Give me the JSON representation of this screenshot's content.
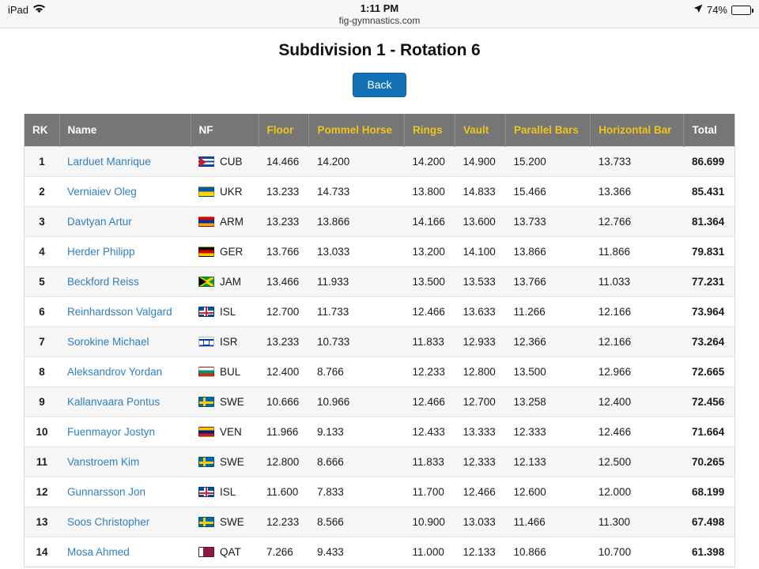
{
  "statusbar": {
    "device": "iPad",
    "wifi_icon": "wifi-icon",
    "time": "1:11 PM",
    "url": "fig-gymnastics.com",
    "location_icon": "location-arrow-icon",
    "battery_percent": "74%",
    "battery_level": 74
  },
  "header": {
    "title": "Subdivision 1 - Rotation 6",
    "back_label": "Back"
  },
  "colors": {
    "header_bg": "#767676",
    "header_apparatus_text": "#f0c419",
    "link": "#2f7fc1",
    "button_bg": "#1272b5"
  },
  "table": {
    "columns": [
      {
        "key": "rk",
        "label": "RK",
        "apparatus": false
      },
      {
        "key": "name",
        "label": "Name",
        "apparatus": false
      },
      {
        "key": "nf",
        "label": "NF",
        "apparatus": false
      },
      {
        "key": "floor",
        "label": "Floor",
        "apparatus": true
      },
      {
        "key": "pommel",
        "label": "Pommel Horse",
        "apparatus": true
      },
      {
        "key": "rings",
        "label": "Rings",
        "apparatus": true
      },
      {
        "key": "vault",
        "label": "Vault",
        "apparatus": true
      },
      {
        "key": "pbars",
        "label": "Parallel Bars",
        "apparatus": true
      },
      {
        "key": "hbar",
        "label": "Horizontal Bar",
        "apparatus": true
      },
      {
        "key": "total",
        "label": "Total",
        "apparatus": false
      }
    ],
    "rows": [
      {
        "rk": "1",
        "name": "Larduet Manrique",
        "nf": "CUB",
        "floor": "14.466",
        "pommel": "14.200",
        "rings": "14.200",
        "vault": "14.900",
        "pbars": "15.200",
        "hbar": "13.733",
        "total": "86.699"
      },
      {
        "rk": "2",
        "name": "Verniaiev Oleg",
        "nf": "UKR",
        "floor": "13.233",
        "pommel": "14.733",
        "rings": "13.800",
        "vault": "14.833",
        "pbars": "15.466",
        "hbar": "13.366",
        "total": "85.431"
      },
      {
        "rk": "3",
        "name": "Davtyan Artur",
        "nf": "ARM",
        "floor": "13.233",
        "pommel": "13.866",
        "rings": "14.166",
        "vault": "13.600",
        "pbars": "13.733",
        "hbar": "12.766",
        "total": "81.364"
      },
      {
        "rk": "4",
        "name": "Herder Philipp",
        "nf": "GER",
        "floor": "13.766",
        "pommel": "13.033",
        "rings": "13.200",
        "vault": "14.100",
        "pbars": "13.866",
        "hbar": "11.866",
        "total": "79.831"
      },
      {
        "rk": "5",
        "name": "Beckford Reiss",
        "nf": "JAM",
        "floor": "13.466",
        "pommel": "11.933",
        "rings": "13.500",
        "vault": "13.533",
        "pbars": "13.766",
        "hbar": "11.033",
        "total": "77.231"
      },
      {
        "rk": "6",
        "name": "Reinhardsson Valgard",
        "nf": "ISL",
        "floor": "12.700",
        "pommel": "11.733",
        "rings": "12.466",
        "vault": "13.633",
        "pbars": "11.266",
        "hbar": "12.166",
        "total": "73.964"
      },
      {
        "rk": "7",
        "name": "Sorokine Michael",
        "nf": "ISR",
        "floor": "13.233",
        "pommel": "10.733",
        "rings": "11.833",
        "vault": "12.933",
        "pbars": "12.366",
        "hbar": "12.166",
        "total": "73.264"
      },
      {
        "rk": "8",
        "name": "Aleksandrov Yordan",
        "nf": "BUL",
        "floor": "12.400",
        "pommel": "8.766",
        "rings": "12.233",
        "vault": "12.800",
        "pbars": "13.500",
        "hbar": "12.966",
        "total": "72.665"
      },
      {
        "rk": "9",
        "name": "Kallanvaara Pontus",
        "nf": "SWE",
        "floor": "10.666",
        "pommel": "10.966",
        "rings": "12.466",
        "vault": "12.700",
        "pbars": "13.258",
        "hbar": "12.400",
        "total": "72.456"
      },
      {
        "rk": "10",
        "name": "Fuenmayor Jostyn",
        "nf": "VEN",
        "floor": "11.966",
        "pommel": "9.133",
        "rings": "12.433",
        "vault": "13.333",
        "pbars": "12.333",
        "hbar": "12.466",
        "total": "71.664"
      },
      {
        "rk": "11",
        "name": "Vanstroem Kim",
        "nf": "SWE",
        "floor": "12.800",
        "pommel": "8.666",
        "rings": "11.833",
        "vault": "12.333",
        "pbars": "12.133",
        "hbar": "12.500",
        "total": "70.265"
      },
      {
        "rk": "12",
        "name": "Gunnarsson Jon",
        "nf": "ISL",
        "floor": "11.600",
        "pommel": "7.833",
        "rings": "11.700",
        "vault": "12.466",
        "pbars": "12.600",
        "hbar": "12.000",
        "total": "68.199"
      },
      {
        "rk": "13",
        "name": "Soos Christopher",
        "nf": "SWE",
        "floor": "12.233",
        "pommel": "8.566",
        "rings": "10.900",
        "vault": "13.033",
        "pbars": "11.466",
        "hbar": "11.300",
        "total": "67.498"
      },
      {
        "rk": "14",
        "name": "Mosa Ahmed",
        "nf": "QAT",
        "floor": "7.266",
        "pommel": "9.433",
        "rings": "11.000",
        "vault": "12.133",
        "pbars": "10.866",
        "hbar": "10.700",
        "total": "61.398"
      }
    ]
  }
}
